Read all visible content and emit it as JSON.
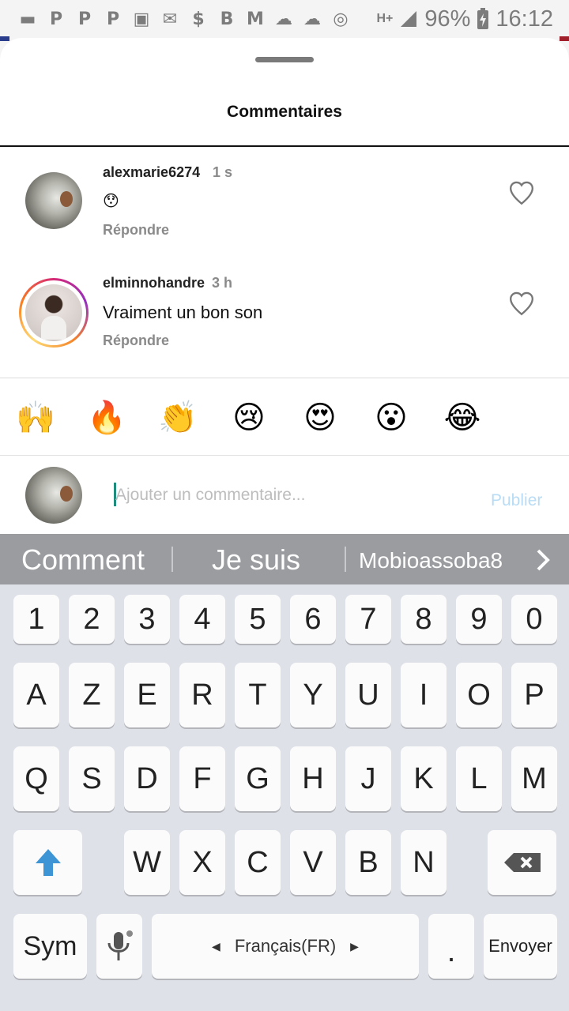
{
  "status_bar": {
    "battery": "96%",
    "time": "16:12",
    "network": "H+"
  },
  "sheet": {
    "title": "Commentaires"
  },
  "comments": [
    {
      "username": "alexmarie6274",
      "time": "1 s",
      "text": "😯",
      "reply_label": "Répondre"
    },
    {
      "username": "elminnohandre",
      "time": "3 h",
      "text": "Vraiment un bon son",
      "reply_label": "Répondre"
    }
  ],
  "quick_reactions": [
    "🙌",
    "🔥",
    "👏",
    "😢",
    "😍",
    "😮",
    "😂"
  ],
  "composer": {
    "placeholder": "Ajouter un commentaire...",
    "publish_label": "Publier"
  },
  "suggestions": [
    "Comment",
    "Je suis",
    "Mobioassoba8"
  ],
  "keyboard": {
    "row_numbers": [
      "1",
      "2",
      "3",
      "4",
      "5",
      "6",
      "7",
      "8",
      "9",
      "0"
    ],
    "row_1": [
      "A",
      "Z",
      "E",
      "R",
      "T",
      "Y",
      "U",
      "I",
      "O",
      "P"
    ],
    "row_2": [
      "Q",
      "S",
      "D",
      "F",
      "G",
      "H",
      "J",
      "K",
      "L",
      "M"
    ],
    "row_3": [
      "W",
      "X",
      "C",
      "V",
      "B",
      "N"
    ],
    "sym_label": "Sym",
    "space_label": "Français(FR)",
    "period_label": ".",
    "send_label": "Envoyer"
  }
}
